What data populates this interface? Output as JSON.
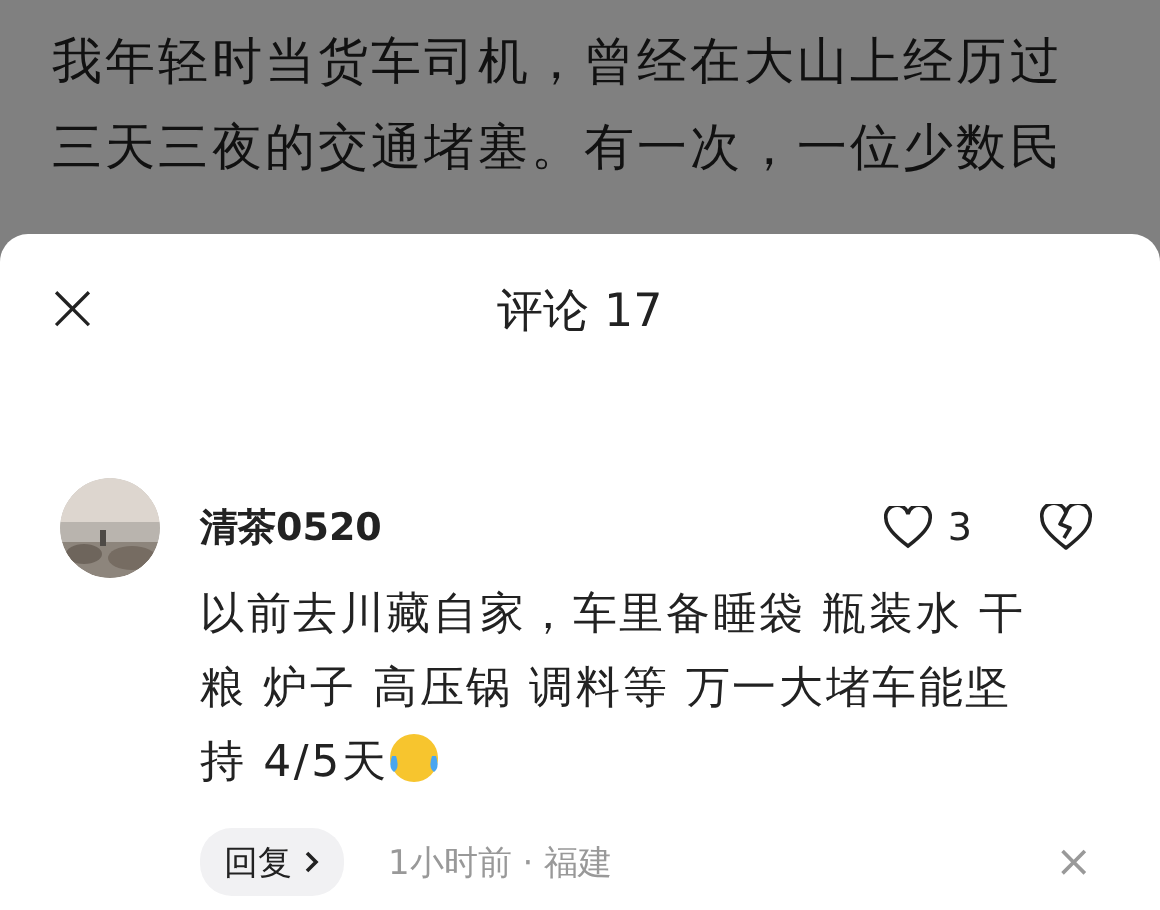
{
  "article": {
    "text": "我年轻时当货车司机，曾经在大山上经历过三天三夜的交通堵塞。有一次，一位少数民"
  },
  "sheet": {
    "close": "×",
    "title": "评论 17"
  },
  "comments": [
    {
      "kind": "picture",
      "user": "清茶0520",
      "likes": "3",
      "liked": false,
      "text": "以前去川藏自家，车里备睡袋 瓶装水 干粮 炉子 高压锅 调料等 万一大堵车能坚持 4/5天",
      "reply": "回复",
      "time": "1小时前 · 福建",
      "dismiss": "×"
    }
  ]
}
